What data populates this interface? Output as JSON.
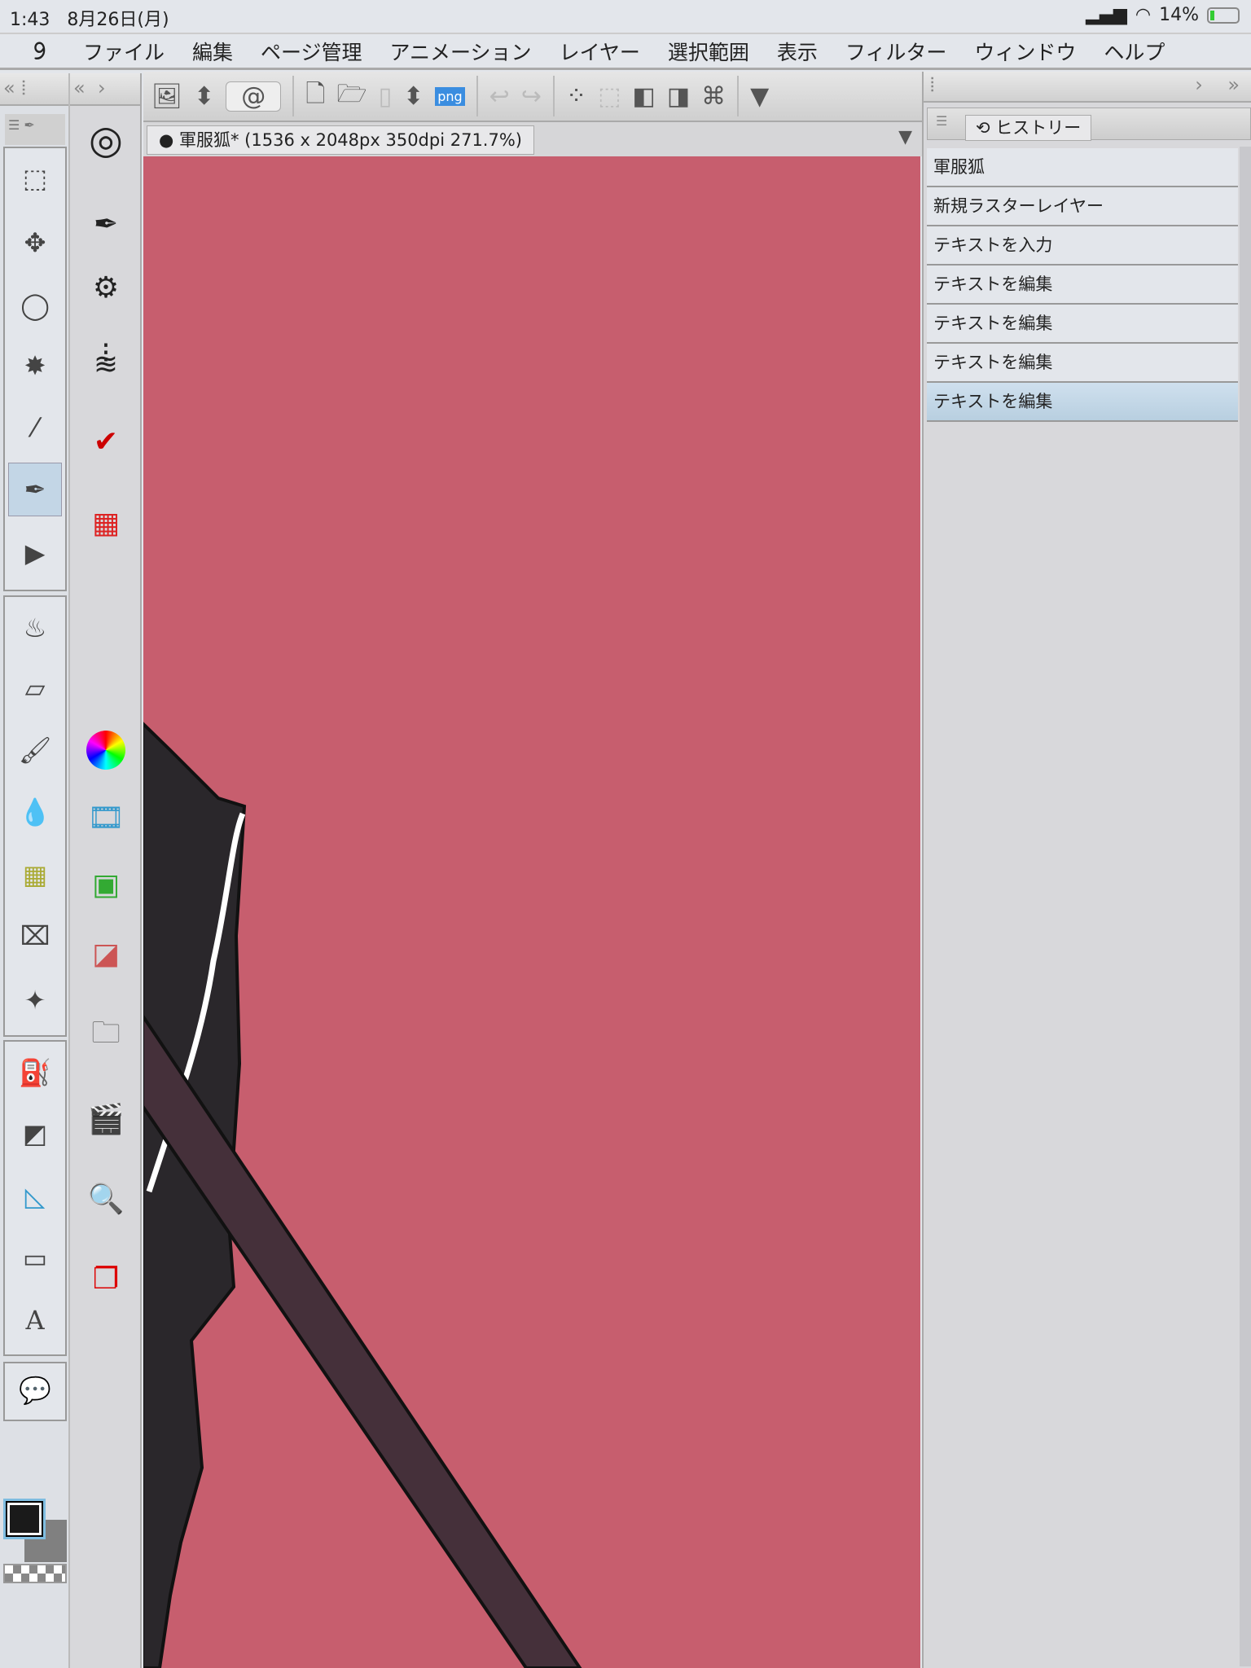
{
  "status": {
    "time": "1:43",
    "date": "8月26日(月)",
    "battery": "14%"
  },
  "menu": [
    "ファイル",
    "編集",
    "ページ管理",
    "アニメーション",
    "レイヤー",
    "選択範囲",
    "表示",
    "フィルター",
    "ウィンドウ",
    "ヘルプ"
  ],
  "toolbar": {
    "png_label": "png"
  },
  "document": {
    "tab": "軍服狐* (1536 x 2048px 350dpi 271.7%)"
  },
  "history": {
    "tab": "ヒストリー",
    "items": [
      "軍服狐",
      "新規ラスターレイヤー",
      "テキストを入力",
      "テキストを編集",
      "テキストを編集",
      "テキストを編集",
      "テキストを編集"
    ],
    "selected_index": 6
  },
  "colors": {
    "canvas": "#c75e6e",
    "main": "#1a1a1a",
    "sub": "#808080"
  }
}
